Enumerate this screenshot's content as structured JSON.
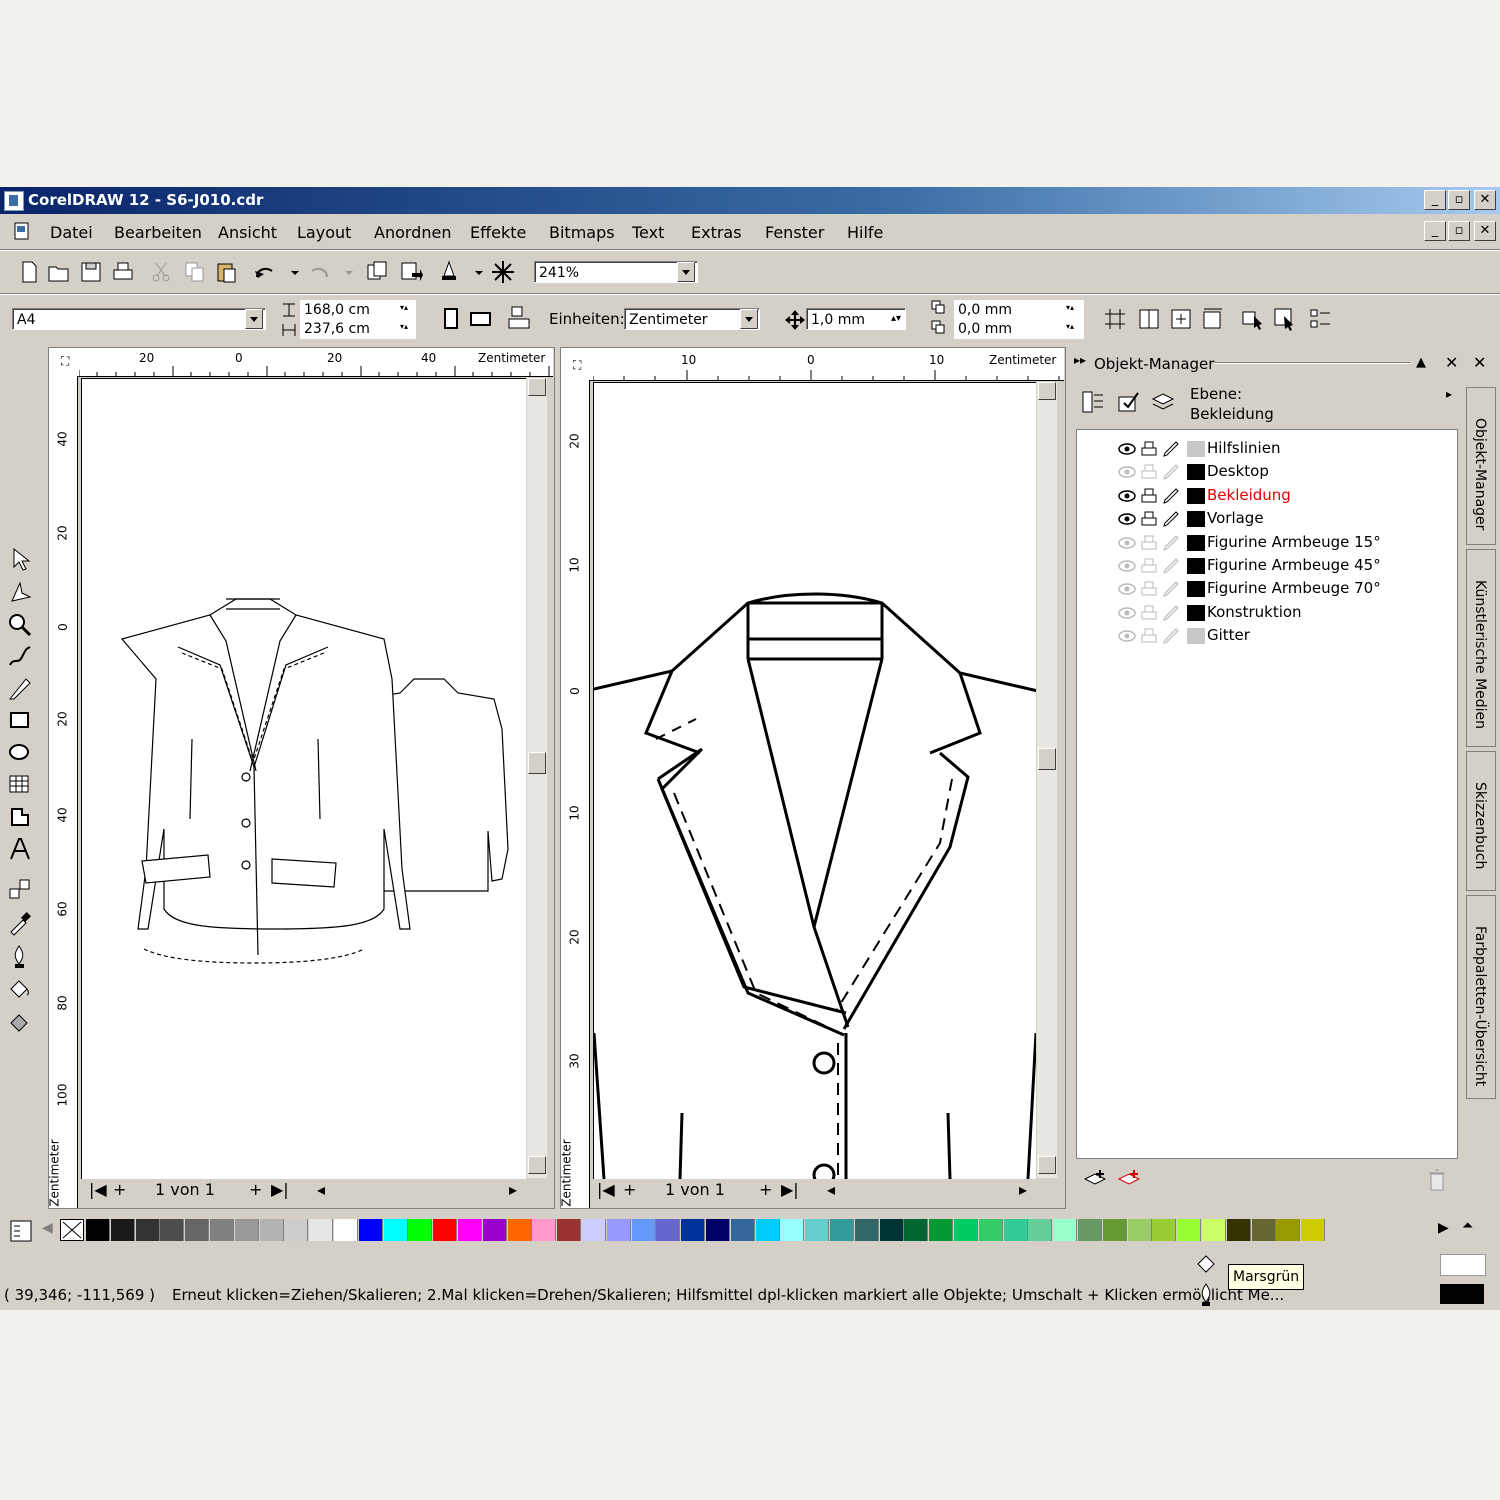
{
  "window": {
    "title": "CorelDRAW 12 - S6-J010.cdr"
  },
  "menu": [
    "Datei",
    "Bearbeiten",
    "Ansicht",
    "Layout",
    "Anordnen",
    "Effekte",
    "Bitmaps",
    "Text",
    "Extras",
    "Fenster",
    "Hilfe"
  ],
  "standard_toolbar": {
    "zoom": "241%"
  },
  "property_bar": {
    "page_size": "A4",
    "width": "168,0 cm",
    "height": "237,6 cm",
    "units_label": "Einheiten:",
    "units_value": "Zentimeter",
    "nudge": "1,0 mm",
    "dup_x": "0,0 mm",
    "dup_y": "0,0 mm"
  },
  "left_view": {
    "ruler_h_labels": [
      "20",
      "0",
      "20",
      "40"
    ],
    "ruler_unit": "Zentimeter",
    "ruler_v_labels": [
      "40",
      "20",
      "0",
      "20",
      "40",
      "60",
      "80",
      "100"
    ],
    "page_counter": "1 von 1"
  },
  "right_view": {
    "ruler_h_labels": [
      "10",
      "0",
      "10"
    ],
    "ruler_unit": "Zentimeter",
    "ruler_v_labels": [
      "20",
      "10",
      "0",
      "10",
      "20",
      "30"
    ],
    "page_counter": "1 von 1"
  },
  "object_manager": {
    "title": "Objekt-Manager",
    "layer_label": "Ebene:",
    "layer_value": "Bekleidung",
    "active_color": "#e00000",
    "layers": [
      {
        "name": "Hilfslinien",
        "swatch": "#c8c8c8",
        "visible": true,
        "active": false
      },
      {
        "name": "Desktop",
        "swatch": "#000000",
        "visible": false,
        "active": false
      },
      {
        "name": "Bekleidung",
        "swatch": "#000000",
        "visible": true,
        "active": true
      },
      {
        "name": "Vorlage",
        "swatch": "#000000",
        "visible": true,
        "active": false
      },
      {
        "name": "Figurine Armbeuge 15°",
        "swatch": "#000000",
        "visible": false,
        "active": false
      },
      {
        "name": "Figurine Armbeuge 45°",
        "swatch": "#000000",
        "visible": false,
        "active": false
      },
      {
        "name": "Figurine Armbeuge 70°",
        "swatch": "#000000",
        "visible": false,
        "active": false
      },
      {
        "name": "Konstruktion",
        "swatch": "#000000",
        "visible": false,
        "active": false
      },
      {
        "name": "Gitter",
        "swatch": "#c8c8c8",
        "visible": false,
        "active": false
      }
    ]
  },
  "docker_tabs": [
    "Objekt-Manager",
    "Künstlerische Medien",
    "Skizzenbuch",
    "Farbpaletten-Übersicht"
  ],
  "palette": [
    "#000000",
    "#1a1a1a",
    "#333333",
    "#4d4d4d",
    "#666666",
    "#808080",
    "#999999",
    "#b3b3b3",
    "#cccccc",
    "#e6e6e6",
    "#ffffff",
    "#0000ff",
    "#00ffff",
    "#00ff00",
    "#ff0000",
    "#ff00ff",
    "#9900cc",
    "#ff6600",
    "#ff99cc",
    "#993333",
    "#ccccff",
    "#9999ff",
    "#6699ff",
    "#6666cc",
    "#003399",
    "#000066",
    "#336699",
    "#00ccff",
    "#99ffff",
    "#66cccc",
    "#339999",
    "#336666",
    "#003333",
    "#006633",
    "#009933",
    "#00cc66",
    "#33cc66",
    "#33cc99",
    "#66cc99",
    "#99ffcc",
    "#669966",
    "#669933",
    "#99cc66",
    "#99cc33",
    "#99ff33",
    "#ccff66",
    "#333300",
    "#666633",
    "#999900",
    "#cccc00"
  ],
  "status": {
    "coords": "( 39,346; -111,569 )",
    "message": "Erneut klicken=Ziehen/Skalieren; 2.Mal klicken=Drehen/Skalieren; Hilfsmittel dpl-klicken markiert alle Objekte; Umschalt + Klicken ermöglicht Me...",
    "tooltip": "Marsgrün",
    "fill_color": "#ffffff",
    "outline_color": "#000000"
  }
}
